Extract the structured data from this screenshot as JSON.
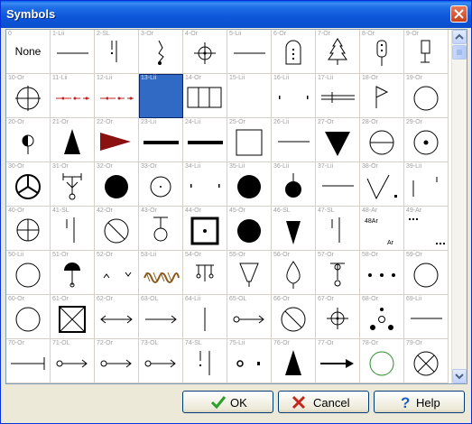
{
  "window": {
    "title": "Symbols"
  },
  "buttons": {
    "ok": "OK",
    "cancel": "Cancel",
    "help": "Help"
  },
  "icons": {
    "close": "close-icon",
    "ok": "checkmark-icon",
    "cancel": "cross-icon",
    "help": "question-icon"
  },
  "colors": {
    "title_bar": "#0a57d9",
    "selected": "#316ac5",
    "ok_green": "#2aa02a",
    "cancel_red": "#c0281e",
    "help_blue": "#1f5fc2"
  },
  "selected_cell_code": "13-Lii",
  "cells": [
    {
      "code": "0",
      "sym": "none",
      "label": "None"
    },
    {
      "code": "1-Lii",
      "sym": "hline"
    },
    {
      "code": "2-SL",
      "sym": "excl"
    },
    {
      "code": "3-Or",
      "sym": "tally"
    },
    {
      "code": "4-Or",
      "sym": "crosshair"
    },
    {
      "code": "5-Lii",
      "sym": "hline"
    },
    {
      "code": "6-Or",
      "sym": "grave"
    },
    {
      "code": "7-Or",
      "sym": "tree"
    },
    {
      "code": "8-Or",
      "sym": "signal"
    },
    {
      "code": "9-Or",
      "sym": "flagpost"
    },
    {
      "code": "10-Or",
      "sym": "crosscircle"
    },
    {
      "code": "11-Lii",
      "sym": "reddash"
    },
    {
      "code": "12-Lii",
      "sym": "reddash"
    },
    {
      "code": "13-Lii",
      "sym": "blank"
    },
    {
      "code": "14-Or",
      "sym": "bars3"
    },
    {
      "code": "15-Lii",
      "sym": "blank"
    },
    {
      "code": "16-Lii",
      "sym": "dots2"
    },
    {
      "code": "17-Lii",
      "sym": "doubleline"
    },
    {
      "code": "18-Or",
      "sym": "flag"
    },
    {
      "code": "19-Or",
      "sym": "circle"
    },
    {
      "code": "20-Or",
      "sym": "halfcircle"
    },
    {
      "code": "21-Or",
      "sym": "triangle"
    },
    {
      "code": "22-Or",
      "sym": "redpennant"
    },
    {
      "code": "23-Lii",
      "sym": "thickline"
    },
    {
      "code": "24-Lii",
      "sym": "thickline"
    },
    {
      "code": "25-Or",
      "sym": "square"
    },
    {
      "code": "26-Lii",
      "sym": "hline"
    },
    {
      "code": "27-Or",
      "sym": "invtriangle"
    },
    {
      "code": "28-Or",
      "sym": "circlehline"
    },
    {
      "code": "29-Or",
      "sym": "circledot"
    },
    {
      "code": "30-Or",
      "sym": "peace"
    },
    {
      "code": "31-Or",
      "sym": "antenna"
    },
    {
      "code": "32-Or",
      "sym": "bigdot"
    },
    {
      "code": "33-Or",
      "sym": "smallcircledot"
    },
    {
      "code": "34-Lii",
      "sym": "dots2"
    },
    {
      "code": "35-Lii",
      "sym": "bigdot"
    },
    {
      "code": "36-Lii",
      "sym": "dotstick"
    },
    {
      "code": "37-Lii",
      "sym": "hline"
    },
    {
      "code": "38-Or",
      "sym": "vshape"
    },
    {
      "code": "39-Lii",
      "sym": "tickmarks"
    },
    {
      "code": "40-Or",
      "sym": "circlehline2"
    },
    {
      "code": "41-SL",
      "sym": "vbars2"
    },
    {
      "code": "42-Or",
      "sym": "slashcircle"
    },
    {
      "code": "43-Or",
      "sym": "pin"
    },
    {
      "code": "44-Or",
      "sym": "boxdot"
    },
    {
      "code": "45-Or",
      "sym": "bigdot"
    },
    {
      "code": "46-SL",
      "sym": "spike"
    },
    {
      "code": "47-SL",
      "sym": "vbars2"
    },
    {
      "code": "48-Ar",
      "sym": "text48"
    },
    {
      "code": "49-Ar",
      "sym": "text49"
    },
    {
      "code": "50-Lii",
      "sym": "circle"
    },
    {
      "code": "51-Or",
      "sym": "balloon"
    },
    {
      "code": "52-Or",
      "sym": "carets"
    },
    {
      "code": "53-Lii",
      "sym": "brownsquiggle"
    },
    {
      "code": "54-Or",
      "sym": "fork"
    },
    {
      "code": "55-Or",
      "sym": "cup"
    },
    {
      "code": "56-Or",
      "sym": "drop"
    },
    {
      "code": "57-Or",
      "sym": "flowerpin"
    },
    {
      "code": "58-Or",
      "sym": "dots3"
    },
    {
      "code": "59-Or",
      "sym": "circle"
    },
    {
      "code": "60-Or",
      "sym": "circle"
    },
    {
      "code": "61-Or",
      "sym": "xbox"
    },
    {
      "code": "62-Or",
      "sym": "doublearrow"
    },
    {
      "code": "63-OL",
      "sym": "arrow"
    },
    {
      "code": "64-Lii",
      "sym": "vline"
    },
    {
      "code": "65-OL",
      "sym": "circlearrow"
    },
    {
      "code": "66-Or",
      "sym": "slashcircle"
    },
    {
      "code": "67-Or",
      "sym": "crosshair"
    },
    {
      "code": "68-Or",
      "sym": "dotcluster"
    },
    {
      "code": "69-Lii",
      "sym": "hline"
    },
    {
      "code": "70-Or",
      "sym": "tline"
    },
    {
      "code": "71-OL",
      "sym": "circlearrow"
    },
    {
      "code": "72-Or",
      "sym": "circlearrow"
    },
    {
      "code": "73-OL",
      "sym": "circlearrow"
    },
    {
      "code": "74-SL",
      "sym": "excl2"
    },
    {
      "code": "75-Lii",
      "sym": "ringdot"
    },
    {
      "code": "76-Or",
      "sym": "triangle"
    },
    {
      "code": "77-Or",
      "sym": "boldarrow"
    },
    {
      "code": "78-Or",
      "sym": "greencircle"
    },
    {
      "code": "79-Or",
      "sym": "xcircle"
    }
  ]
}
